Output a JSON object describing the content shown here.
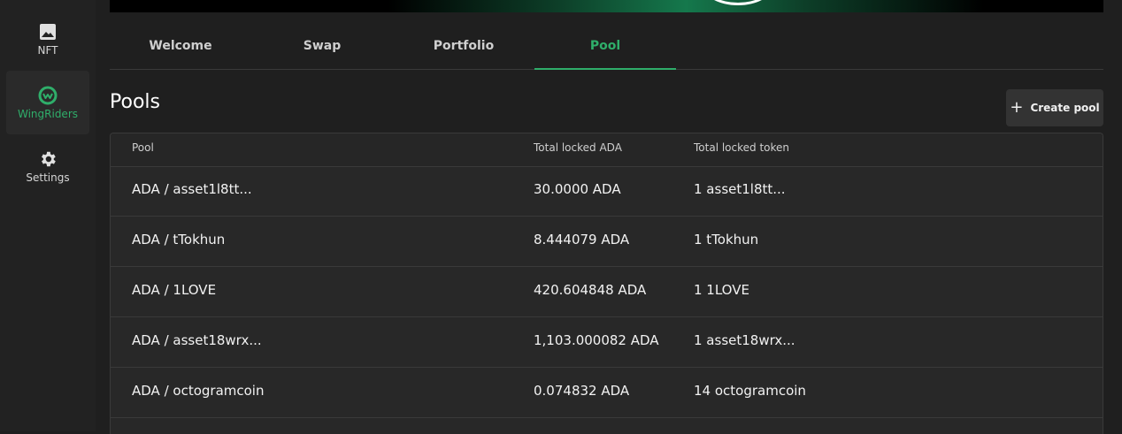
{
  "sidebar": {
    "items": [
      {
        "label": "NFT",
        "icon": "image-icon"
      },
      {
        "label": "WingRiders",
        "icon": "wingriders-logo-icon"
      },
      {
        "label": "Settings",
        "icon": "gear-icon"
      }
    ]
  },
  "tabs": [
    {
      "label": "Welcome"
    },
    {
      "label": "Swap"
    },
    {
      "label": "Portfolio"
    },
    {
      "label": "Pool",
      "active": true
    }
  ],
  "header": {
    "title": "Pools",
    "create_label": "Create pool",
    "create_icon": "plus-icon"
  },
  "table": {
    "columns": [
      "Pool",
      "Total locked ADA",
      "Total locked token"
    ],
    "rows": [
      [
        "ADA / asset1l8tt...",
        "30.0000 ADA",
        "1 asset1l8tt..."
      ],
      [
        "ADA / tTokhun",
        "8.444079 ADA",
        "1 tTokhun"
      ],
      [
        "ADA / 1LOVE",
        "420.604848 ADA",
        "1 1LOVE"
      ],
      [
        "ADA / asset18wrx...",
        "1,103.000082 ADA",
        "1 asset18wrx..."
      ],
      [
        "ADA / octogramcoin",
        "0.074832 ADA",
        "14 octogramcoin"
      ]
    ]
  },
  "colors": {
    "accent": "#2fae6a",
    "background": "#1f1f1f",
    "surface": "#282828"
  }
}
